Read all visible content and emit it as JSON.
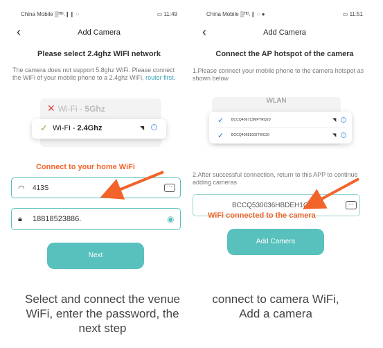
{
  "left": {
    "status": {
      "carrier": "China Mobile ▒ᴴᴰ.❙❙ ◌",
      "battery": "▭ 11:49"
    },
    "nav": {
      "back_icon": "‹",
      "title": "Add Camera"
    },
    "heading": "Please select 2.4ghz WIFI network",
    "description": "The camera does not support 5.8ghz WiFi. Please connect the WiFi of your mobile phone to a 2.4ghz WiFi,",
    "router_link": "router first.",
    "wifi_5g": {
      "prefix": "Wi-Fi - ",
      "band": "5Ghz"
    },
    "wifi_24": {
      "prefix": "Wi-Fi - ",
      "band": "2.4Ghz"
    },
    "annotation": "Connect to your home WiFi",
    "ssid_value": "413S",
    "password_value": "18818523886.",
    "more_label": "···",
    "next_label": "Next",
    "caption": "Select and connect the venue WiFi, enter the password, the next step"
  },
  "right": {
    "status": {
      "carrier": "China Mobile ▒ᴴᴰ.❙ ◌ ●",
      "battery": "▭ 11:51"
    },
    "nav": {
      "back_icon": "‹",
      "title": "Add Camera"
    },
    "heading": "Connect the AP hotspot of the camera",
    "step1": "1.Please connect your mobile phone to the camera hotspot as shown below",
    "wlan_title": "WLAN",
    "wlan_items": [
      {
        "ssid": "BCCQ406713MPYRQ20"
      },
      {
        "ssid": "BCCQ406816GITWC20"
      }
    ],
    "step2": "2.After successful connection, return to this APP to continue adding cameras",
    "hotspot_value": "BCCQ530036HBDEH1O",
    "more_label": "···",
    "annotation": "WiFi connected to the camera",
    "add_camera_label": "Add Camera",
    "caption": "connect to camera WiFi, Add a camera"
  },
  "colors": {
    "accent": "#58c0bd",
    "annotation": "#f2632a",
    "link": "#2ea2b6"
  },
  "icons": [
    "back-icon",
    "x-mark-icon",
    "check-icon",
    "wifi-signal-icon",
    "info-icon",
    "lock-icon",
    "eye-icon",
    "more-icon",
    "arrow-icon"
  ]
}
